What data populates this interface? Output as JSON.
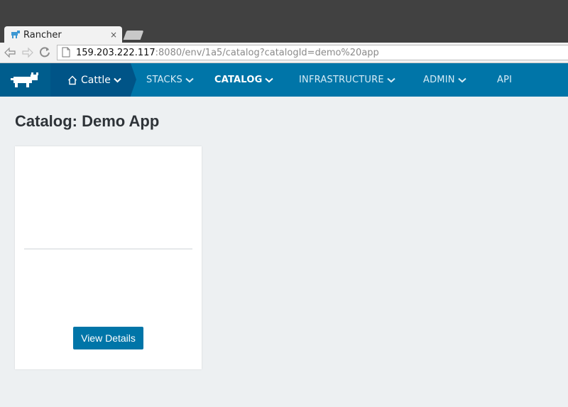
{
  "browser": {
    "tab_title": "Rancher",
    "tab_close": "×",
    "url_host": "159.203.222.117",
    "url_path": ":8080/env/1a5/catalog?catalogId=demo%20app"
  },
  "navbar": {
    "environment": "Cattle",
    "items": [
      {
        "label": "STACKS"
      },
      {
        "label": "CATALOG"
      },
      {
        "label": "INFRASTRUCTURE"
      },
      {
        "label": "ADMIN"
      },
      {
        "label": "API"
      }
    ],
    "active": "CATALOG",
    "colors": {
      "bar": "#0075a8",
      "brand": "#005d8d",
      "env": "#005487"
    }
  },
  "page": {
    "title": "Catalog: Demo App"
  },
  "card": {
    "button_label": "View Details"
  }
}
